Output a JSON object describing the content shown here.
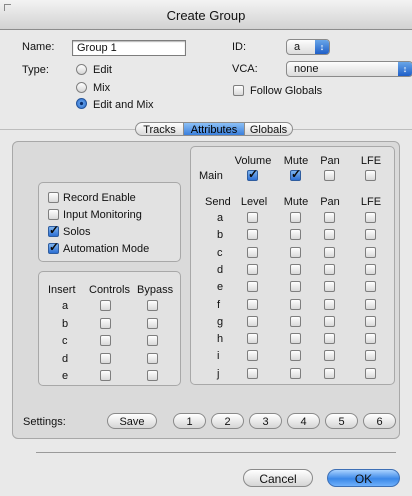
{
  "window": {
    "title": "Create Group"
  },
  "form": {
    "name_label": "Name:",
    "name_value": "Group 1",
    "type_label": "Type:",
    "type_options": [
      "Edit",
      "Mix",
      "Edit and Mix"
    ],
    "type_selected": "Edit and Mix",
    "id_label": "ID:",
    "id_value": "a",
    "vca_label": "VCA:",
    "vca_value": "none",
    "follow_globals_label": "Follow Globals",
    "follow_globals_checked": false
  },
  "tabs": [
    {
      "label": "Tracks",
      "selected": false
    },
    {
      "label": "Attributes",
      "selected": true
    },
    {
      "label": "Globals",
      "selected": false
    }
  ],
  "attributes": [
    {
      "label": "Record Enable",
      "checked": false
    },
    {
      "label": "Input Monitoring",
      "checked": false
    },
    {
      "label": "Solos",
      "checked": true
    },
    {
      "label": "Automation Mode",
      "checked": true
    }
  ],
  "inserts": {
    "headers": [
      "Insert",
      "Controls",
      "Bypass"
    ],
    "rows": [
      "a",
      "b",
      "c",
      "d",
      "e"
    ]
  },
  "main_section": {
    "row_label": "Main",
    "headers": [
      "Volume",
      "Mute",
      "Pan",
      "LFE"
    ],
    "checked": [
      true,
      true,
      false,
      false
    ]
  },
  "sends": {
    "headers": [
      "Send",
      "Level",
      "Mute",
      "Pan",
      "LFE"
    ],
    "rows": [
      "a",
      "b",
      "c",
      "d",
      "e",
      "f",
      "g",
      "h",
      "i",
      "j"
    ]
  },
  "settings": {
    "label": "Settings:",
    "save_label": "Save",
    "slots": [
      "1",
      "2",
      "3",
      "4",
      "5",
      "6"
    ]
  },
  "buttons": {
    "cancel": "Cancel",
    "ok": "OK"
  }
}
